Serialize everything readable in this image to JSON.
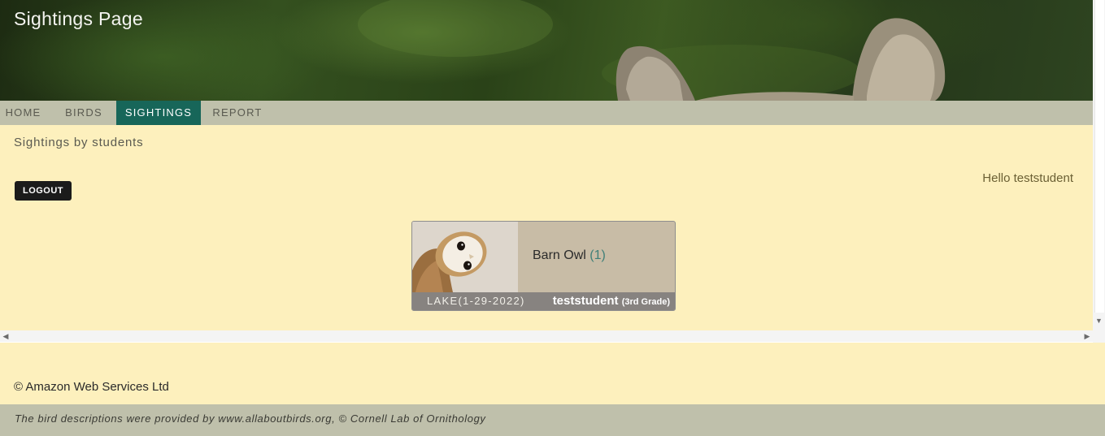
{
  "header": {
    "title": "Sightings Page"
  },
  "nav": {
    "items": [
      {
        "label": "HOME",
        "active": false
      },
      {
        "label": "BIRDS",
        "active": false
      },
      {
        "label": "SIGHTINGS",
        "active": true
      },
      {
        "label": "REPORT",
        "active": false
      }
    ]
  },
  "main": {
    "heading": "Sightings by students",
    "greeting": "Hello teststudent",
    "logout_label": "LOGOUT"
  },
  "sightings": [
    {
      "bird": "Barn Owl",
      "count": "(1)",
      "location": "LAKE(1-29-2022)",
      "student": "teststudent",
      "grade": "(3rd Grade)"
    }
  ],
  "footer": {
    "copyright": "© Amazon Web Services Ltd",
    "note": "The bird descriptions were provided by www.allaboutbirds.org, © Cornell Lab of Ornithology"
  },
  "colors": {
    "nav_active": "#176659",
    "nav_bar": "#bfc0ab",
    "content_bg": "#fdf0bd",
    "card_bg": "#c8bca6"
  }
}
